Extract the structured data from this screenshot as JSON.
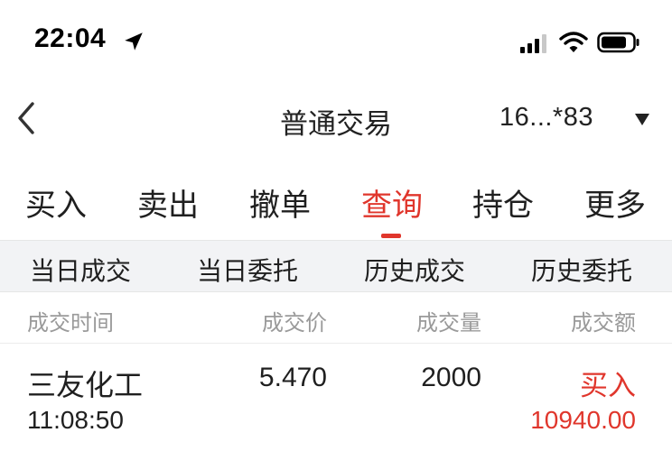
{
  "status_bar": {
    "time": "22:04",
    "icons": [
      "location-arrow-icon",
      "cellular-signal-icon",
      "wifi-icon",
      "battery-icon"
    ]
  },
  "nav": {
    "back_icon": "chevron-left-icon",
    "title": "普通交易",
    "account": "16...*83",
    "account_dropdown_icon": "triangle-down-icon"
  },
  "main_tabs": [
    {
      "label": "买入",
      "active": false
    },
    {
      "label": "卖出",
      "active": false
    },
    {
      "label": "撤单",
      "active": false
    },
    {
      "label": "查询",
      "active": true
    },
    {
      "label": "持仓",
      "active": false
    },
    {
      "label": "更多",
      "active": false
    }
  ],
  "sub_tabs": [
    {
      "label": "当日成交"
    },
    {
      "label": "当日委托"
    },
    {
      "label": "历史成交"
    },
    {
      "label": "历史委托"
    }
  ],
  "table": {
    "headers": [
      "成交时间",
      "成交价",
      "成交量",
      "成交额"
    ],
    "rows": [
      {
        "name": "三友化工",
        "time": "11:08:50",
        "price": "5.470",
        "quantity": "2000",
        "direction": "买入",
        "amount": "10940.00"
      }
    ]
  },
  "colors": {
    "accent_red": "#e0362c",
    "header_gray": "#9a9a9a",
    "subtab_bg": "#f2f3f5"
  }
}
